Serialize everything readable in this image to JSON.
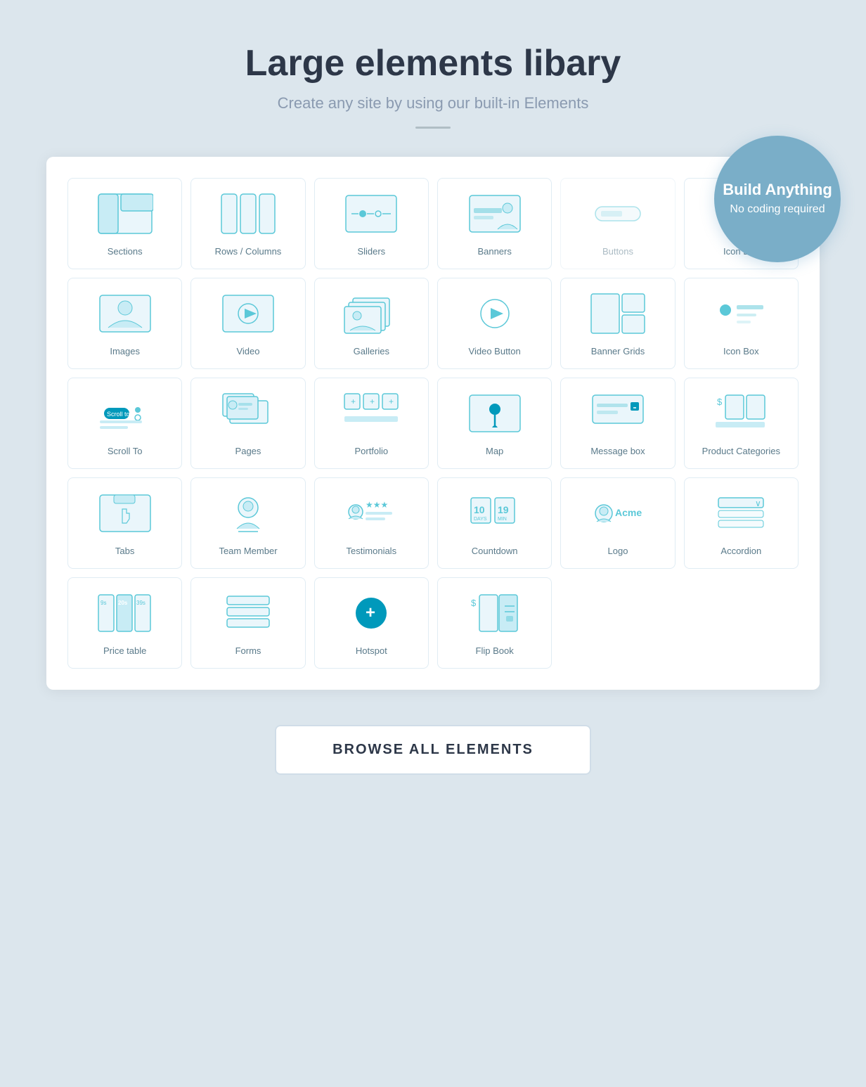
{
  "header": {
    "title": "Large elements libary",
    "subtitle": "Create any site by using our built-in Elements"
  },
  "badge": {
    "line1": "Build Anything",
    "line2": "No coding required"
  },
  "elements": [
    {
      "id": "sections",
      "label": "Sections",
      "icon": "sections"
    },
    {
      "id": "rows-columns",
      "label": "Rows / Columns",
      "icon": "rows-columns"
    },
    {
      "id": "sliders",
      "label": "Sliders",
      "icon": "sliders"
    },
    {
      "id": "banners",
      "label": "Banners",
      "icon": "banners"
    },
    {
      "id": "buttons",
      "label": "Buttons",
      "icon": "buttons"
    },
    {
      "id": "icon-box",
      "label": "Icon Box",
      "icon": "icon-box"
    },
    {
      "id": "images",
      "label": "Images",
      "icon": "images"
    },
    {
      "id": "video",
      "label": "Video",
      "icon": "video"
    },
    {
      "id": "galleries",
      "label": "Galleries",
      "icon": "galleries"
    },
    {
      "id": "video-button",
      "label": "Video Button",
      "icon": "video-button"
    },
    {
      "id": "banner-grids",
      "label": "Banner Grids",
      "icon": "banner-grids"
    },
    {
      "id": "icon-box2",
      "label": "Icon Box",
      "icon": "icon-box2"
    },
    {
      "id": "scroll-to",
      "label": "Scroll To",
      "icon": "scroll-to"
    },
    {
      "id": "pages",
      "label": "Pages",
      "icon": "pages"
    },
    {
      "id": "portfolio",
      "label": "Portfolio",
      "icon": "portfolio"
    },
    {
      "id": "map",
      "label": "Map",
      "icon": "map"
    },
    {
      "id": "message-box",
      "label": "Message box",
      "icon": "message-box"
    },
    {
      "id": "product-categories",
      "label": "Product Categories",
      "icon": "product-categories"
    },
    {
      "id": "tabs",
      "label": "Tabs",
      "icon": "tabs"
    },
    {
      "id": "team-member",
      "label": "Team Member",
      "icon": "team-member"
    },
    {
      "id": "testimonials",
      "label": "Testimonials",
      "icon": "testimonials"
    },
    {
      "id": "countdown",
      "label": "Countdown",
      "icon": "countdown"
    },
    {
      "id": "logo",
      "label": "Logo",
      "icon": "logo"
    },
    {
      "id": "accordion",
      "label": "Accordion",
      "icon": "accordion"
    },
    {
      "id": "price-table",
      "label": "Price table",
      "icon": "price-table"
    },
    {
      "id": "forms",
      "label": "Forms",
      "icon": "forms"
    },
    {
      "id": "hotspot",
      "label": "Hotspot",
      "icon": "hotspot"
    },
    {
      "id": "flip-book",
      "label": "Flip Book",
      "icon": "flip-book"
    }
  ],
  "browse_button": "BROWSE ALL ELEMENTS"
}
